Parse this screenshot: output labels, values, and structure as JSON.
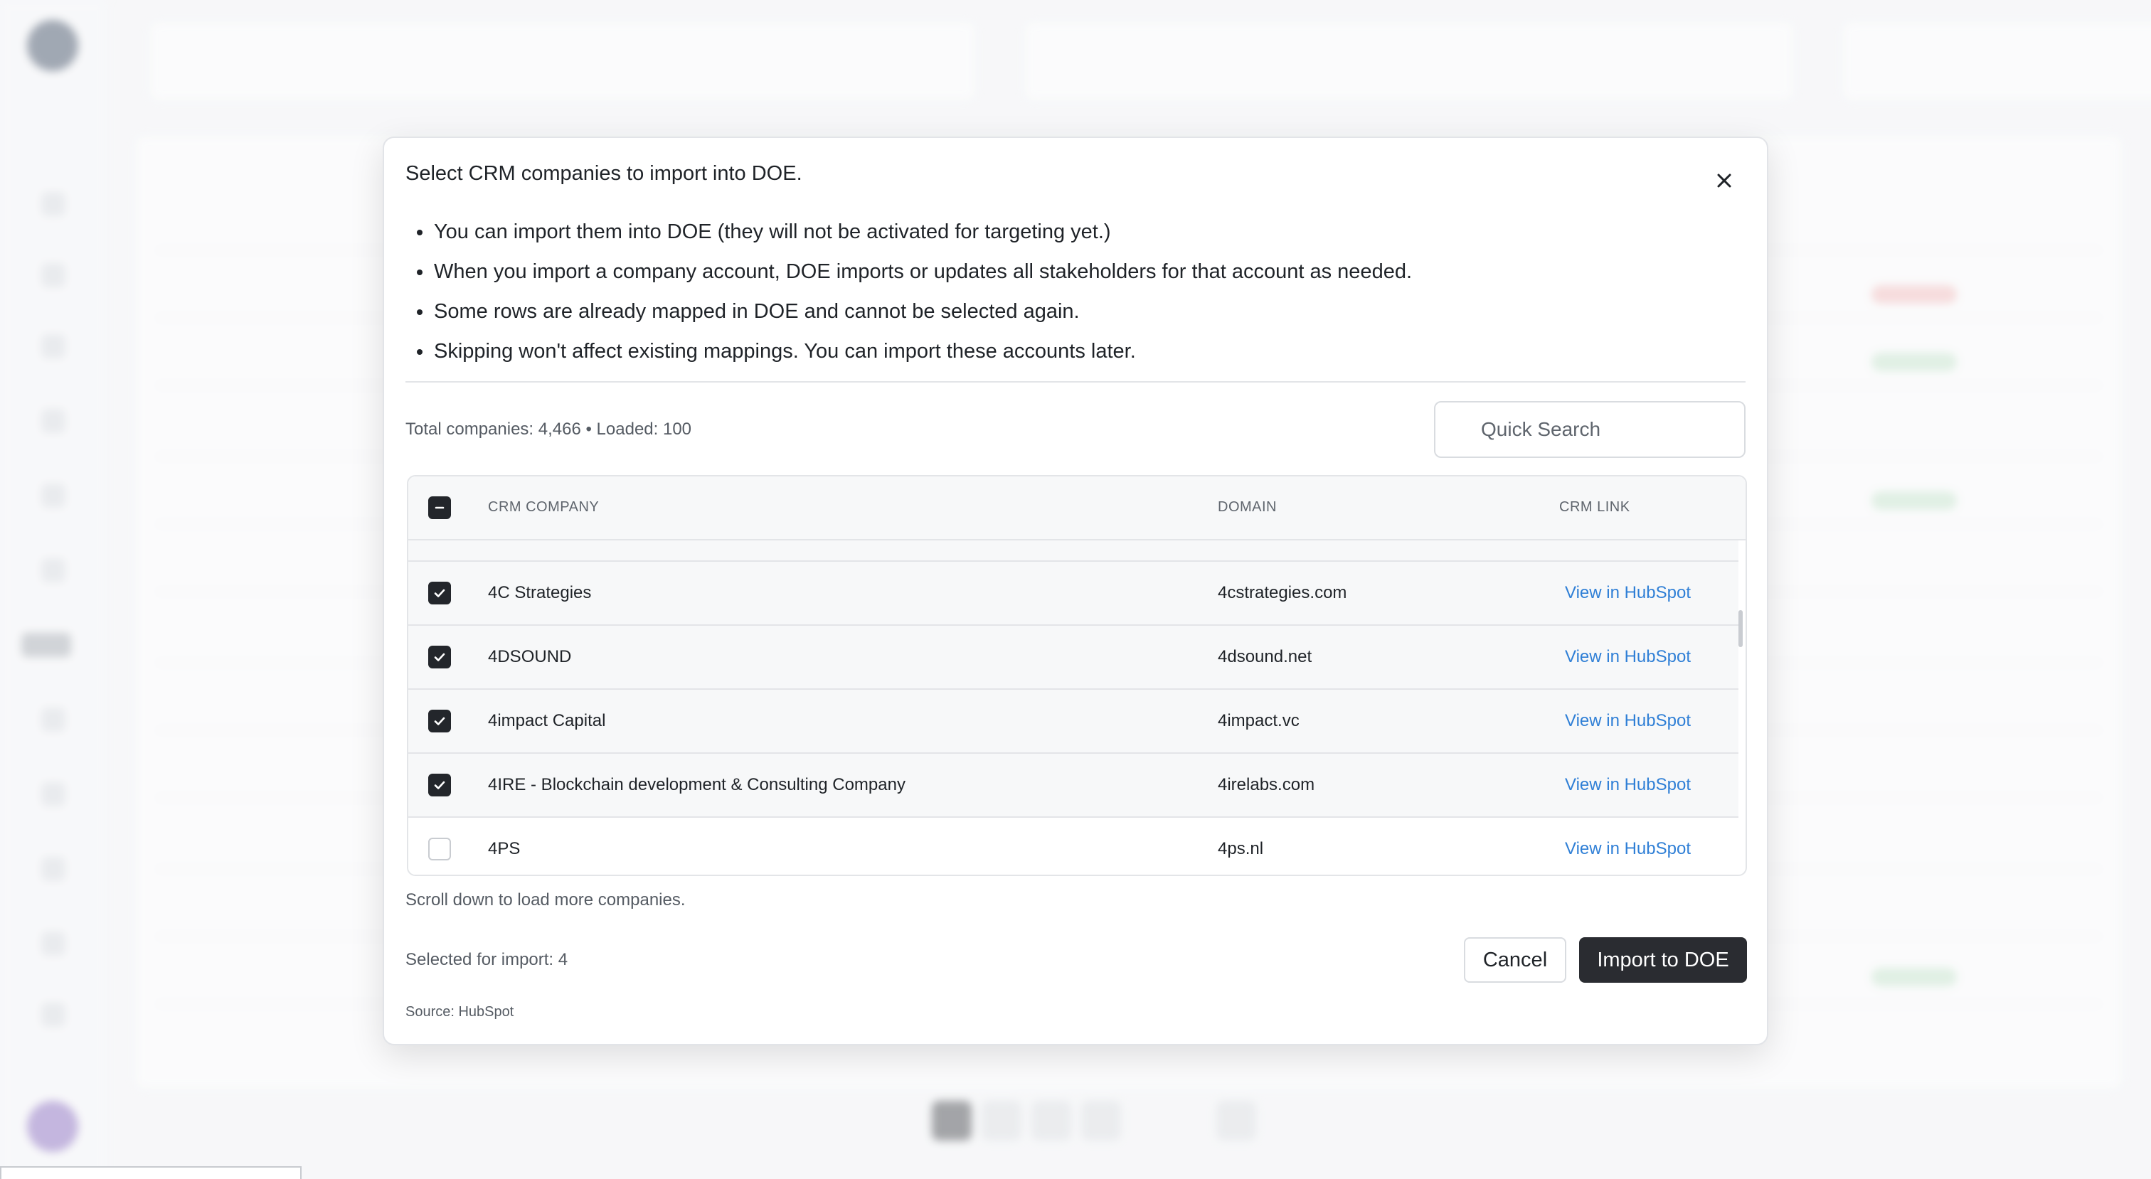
{
  "modal": {
    "title": "Select CRM companies to import into DOE.",
    "bullets": [
      "You can import them into DOE (they will not be activated for targeting yet.)",
      "When you import a company account, DOE imports or updates all stakeholders for that account as needed.",
      "Some rows are already mapped in DOE and cannot be selected again.",
      "Skipping won't affect existing mappings. You can import these accounts later."
    ],
    "totals": "Total companies: 4,466 • Loaded: 100",
    "search_placeholder": "Quick Search",
    "columns": {
      "company": "CRM COMPANY",
      "domain": "DOMAIN",
      "link": "CRM LINK"
    },
    "rows": [
      {
        "company": "4C Strategies",
        "domain": "4cstrategies.com",
        "link": "View in HubSpot",
        "checked": true
      },
      {
        "company": "4DSOUND",
        "domain": "4dsound.net",
        "link": "View in HubSpot",
        "checked": true
      },
      {
        "company": "4impact Capital",
        "domain": "4impact.vc",
        "link": "View in HubSpot",
        "checked": true
      },
      {
        "company": "4IRE - Blockchain development & Consulting Company",
        "domain": "4irelabs.com",
        "link": "View in HubSpot",
        "checked": true
      },
      {
        "company": "4PS",
        "domain": "4ps.nl",
        "link": "View in HubSpot",
        "checked": false
      }
    ],
    "hint": "Scroll down to load more companies.",
    "selected_count": "Selected for import: 4",
    "source": "Source: HubSpot",
    "cancel_label": "Cancel",
    "import_label": "Import to DOE"
  },
  "icons": {
    "close": "close-icon",
    "check": "checkmark-icon",
    "indeterminate": "minus-icon"
  },
  "colors": {
    "link": "#2f7fd6",
    "primary_button": "#2a2c31",
    "checkbox_checked": "#23262b"
  }
}
